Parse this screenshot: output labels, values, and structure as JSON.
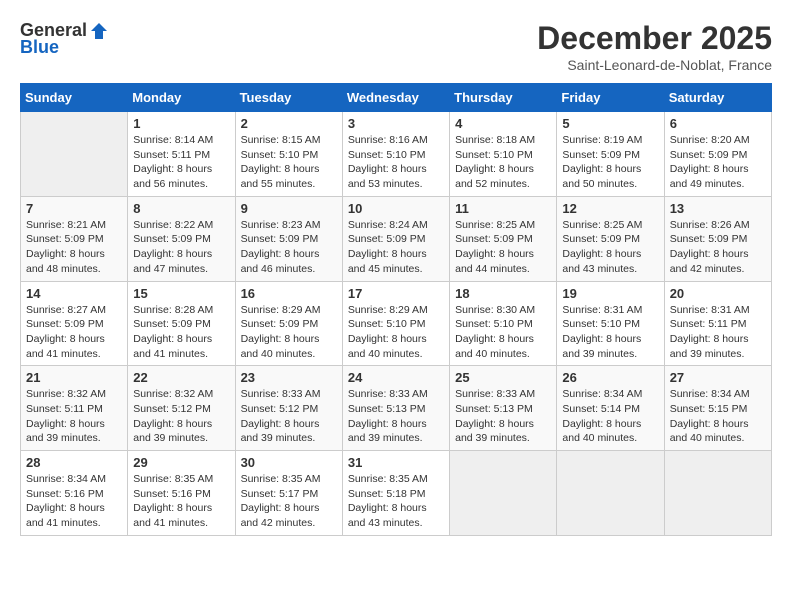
{
  "header": {
    "logo_general": "General",
    "logo_blue": "Blue",
    "month_title": "December 2025",
    "subtitle": "Saint-Leonard-de-Noblat, France"
  },
  "calendar": {
    "days_of_week": [
      "Sunday",
      "Monday",
      "Tuesday",
      "Wednesday",
      "Thursday",
      "Friday",
      "Saturday"
    ],
    "weeks": [
      [
        {
          "day": null
        },
        {
          "day": 1,
          "sunrise": "Sunrise: 8:14 AM",
          "sunset": "Sunset: 5:11 PM",
          "daylight": "Daylight: 8 hours and 56 minutes."
        },
        {
          "day": 2,
          "sunrise": "Sunrise: 8:15 AM",
          "sunset": "Sunset: 5:10 PM",
          "daylight": "Daylight: 8 hours and 55 minutes."
        },
        {
          "day": 3,
          "sunrise": "Sunrise: 8:16 AM",
          "sunset": "Sunset: 5:10 PM",
          "daylight": "Daylight: 8 hours and 53 minutes."
        },
        {
          "day": 4,
          "sunrise": "Sunrise: 8:18 AM",
          "sunset": "Sunset: 5:10 PM",
          "daylight": "Daylight: 8 hours and 52 minutes."
        },
        {
          "day": 5,
          "sunrise": "Sunrise: 8:19 AM",
          "sunset": "Sunset: 5:09 PM",
          "daylight": "Daylight: 8 hours and 50 minutes."
        },
        {
          "day": 6,
          "sunrise": "Sunrise: 8:20 AM",
          "sunset": "Sunset: 5:09 PM",
          "daylight": "Daylight: 8 hours and 49 minutes."
        }
      ],
      [
        {
          "day": 7,
          "sunrise": "Sunrise: 8:21 AM",
          "sunset": "Sunset: 5:09 PM",
          "daylight": "Daylight: 8 hours and 48 minutes."
        },
        {
          "day": 8,
          "sunrise": "Sunrise: 8:22 AM",
          "sunset": "Sunset: 5:09 PM",
          "daylight": "Daylight: 8 hours and 47 minutes."
        },
        {
          "day": 9,
          "sunrise": "Sunrise: 8:23 AM",
          "sunset": "Sunset: 5:09 PM",
          "daylight": "Daylight: 8 hours and 46 minutes."
        },
        {
          "day": 10,
          "sunrise": "Sunrise: 8:24 AM",
          "sunset": "Sunset: 5:09 PM",
          "daylight": "Daylight: 8 hours and 45 minutes."
        },
        {
          "day": 11,
          "sunrise": "Sunrise: 8:25 AM",
          "sunset": "Sunset: 5:09 PM",
          "daylight": "Daylight: 8 hours and 44 minutes."
        },
        {
          "day": 12,
          "sunrise": "Sunrise: 8:25 AM",
          "sunset": "Sunset: 5:09 PM",
          "daylight": "Daylight: 8 hours and 43 minutes."
        },
        {
          "day": 13,
          "sunrise": "Sunrise: 8:26 AM",
          "sunset": "Sunset: 5:09 PM",
          "daylight": "Daylight: 8 hours and 42 minutes."
        }
      ],
      [
        {
          "day": 14,
          "sunrise": "Sunrise: 8:27 AM",
          "sunset": "Sunset: 5:09 PM",
          "daylight": "Daylight: 8 hours and 41 minutes."
        },
        {
          "day": 15,
          "sunrise": "Sunrise: 8:28 AM",
          "sunset": "Sunset: 5:09 PM",
          "daylight": "Daylight: 8 hours and 41 minutes."
        },
        {
          "day": 16,
          "sunrise": "Sunrise: 8:29 AM",
          "sunset": "Sunset: 5:09 PM",
          "daylight": "Daylight: 8 hours and 40 minutes."
        },
        {
          "day": 17,
          "sunrise": "Sunrise: 8:29 AM",
          "sunset": "Sunset: 5:10 PM",
          "daylight": "Daylight: 8 hours and 40 minutes."
        },
        {
          "day": 18,
          "sunrise": "Sunrise: 8:30 AM",
          "sunset": "Sunset: 5:10 PM",
          "daylight": "Daylight: 8 hours and 40 minutes."
        },
        {
          "day": 19,
          "sunrise": "Sunrise: 8:31 AM",
          "sunset": "Sunset: 5:10 PM",
          "daylight": "Daylight: 8 hours and 39 minutes."
        },
        {
          "day": 20,
          "sunrise": "Sunrise: 8:31 AM",
          "sunset": "Sunset: 5:11 PM",
          "daylight": "Daylight: 8 hours and 39 minutes."
        }
      ],
      [
        {
          "day": 21,
          "sunrise": "Sunrise: 8:32 AM",
          "sunset": "Sunset: 5:11 PM",
          "daylight": "Daylight: 8 hours and 39 minutes."
        },
        {
          "day": 22,
          "sunrise": "Sunrise: 8:32 AM",
          "sunset": "Sunset: 5:12 PM",
          "daylight": "Daylight: 8 hours and 39 minutes."
        },
        {
          "day": 23,
          "sunrise": "Sunrise: 8:33 AM",
          "sunset": "Sunset: 5:12 PM",
          "daylight": "Daylight: 8 hours and 39 minutes."
        },
        {
          "day": 24,
          "sunrise": "Sunrise: 8:33 AM",
          "sunset": "Sunset: 5:13 PM",
          "daylight": "Daylight: 8 hours and 39 minutes."
        },
        {
          "day": 25,
          "sunrise": "Sunrise: 8:33 AM",
          "sunset": "Sunset: 5:13 PM",
          "daylight": "Daylight: 8 hours and 39 minutes."
        },
        {
          "day": 26,
          "sunrise": "Sunrise: 8:34 AM",
          "sunset": "Sunset: 5:14 PM",
          "daylight": "Daylight: 8 hours and 40 minutes."
        },
        {
          "day": 27,
          "sunrise": "Sunrise: 8:34 AM",
          "sunset": "Sunset: 5:15 PM",
          "daylight": "Daylight: 8 hours and 40 minutes."
        }
      ],
      [
        {
          "day": 28,
          "sunrise": "Sunrise: 8:34 AM",
          "sunset": "Sunset: 5:16 PM",
          "daylight": "Daylight: 8 hours and 41 minutes."
        },
        {
          "day": 29,
          "sunrise": "Sunrise: 8:35 AM",
          "sunset": "Sunset: 5:16 PM",
          "daylight": "Daylight: 8 hours and 41 minutes."
        },
        {
          "day": 30,
          "sunrise": "Sunrise: 8:35 AM",
          "sunset": "Sunset: 5:17 PM",
          "daylight": "Daylight: 8 hours and 42 minutes."
        },
        {
          "day": 31,
          "sunrise": "Sunrise: 8:35 AM",
          "sunset": "Sunset: 5:18 PM",
          "daylight": "Daylight: 8 hours and 43 minutes."
        },
        {
          "day": null
        },
        {
          "day": null
        },
        {
          "day": null
        }
      ]
    ]
  }
}
